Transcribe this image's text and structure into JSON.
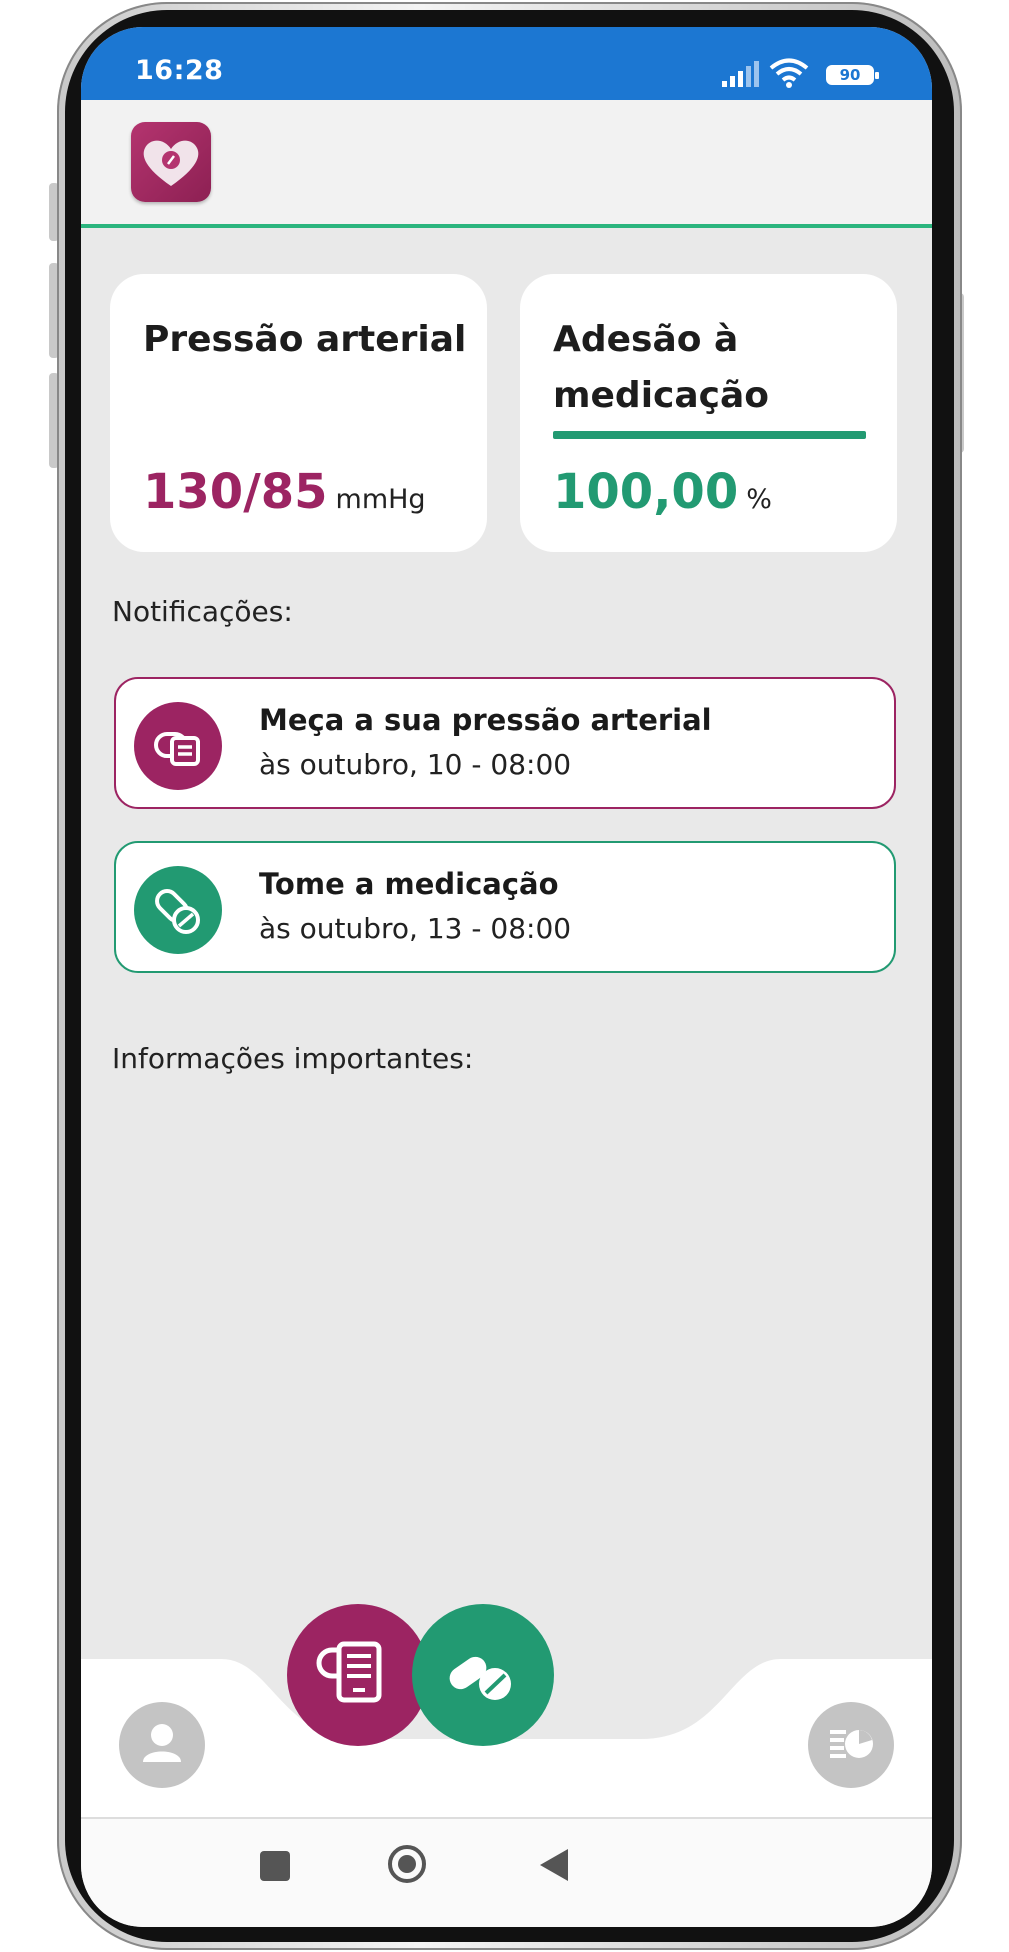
{
  "status_bar": {
    "time": "16:28",
    "battery": "90"
  },
  "cards": {
    "blood_pressure": {
      "title": "Pressão arterial",
      "value": "130/85",
      "unit": "mmHg"
    },
    "adherence": {
      "title_line1": "Adesão à",
      "title_line2": "medicação",
      "value": "100,00",
      "unit": "%",
      "progress": 1.0
    }
  },
  "notifications_label": "Notificações:",
  "notifications": [
    {
      "title": "Meça a sua pressão arterial",
      "subtitle": "às outubro, 10 - 08:00",
      "icon": "blood-pressure-monitor-icon",
      "color": "#9c2462"
    },
    {
      "title": "Tome a medicação",
      "subtitle": "às outubro, 13 - 08:00",
      "icon": "pills-icon",
      "color": "#229a72"
    }
  ],
  "important_info_label": "Informações importantes:",
  "colors": {
    "accent_pressure": "#9c2462",
    "accent_medication": "#229a72",
    "status_bar": "#1c77d2",
    "appbar_divider": "#2bb57e"
  }
}
